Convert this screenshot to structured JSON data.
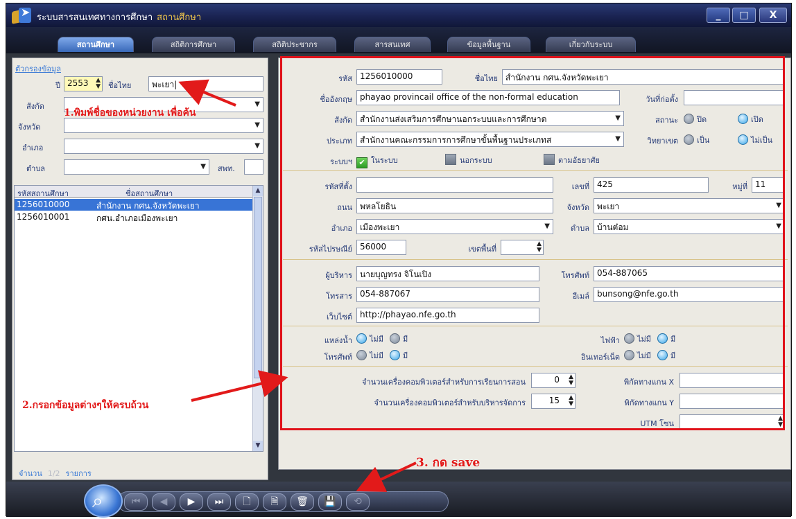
{
  "window": {
    "title": "ระบบสารสนเทศทางการศึกษา",
    "subtitle": "สถานศึกษา",
    "controls": [
      "_",
      "□",
      "X"
    ]
  },
  "tabs": [
    {
      "label": "สถานศึกษา",
      "active": true
    },
    {
      "label": "สถิติการศึกษา",
      "active": false
    },
    {
      "label": "สถิติประชากร",
      "active": false
    },
    {
      "label": "สารสนเทศ",
      "active": false
    },
    {
      "label": "ข้อมูลพื้นฐาน",
      "active": false
    },
    {
      "label": "เกี่ยวกับระบบ",
      "active": false
    }
  ],
  "filter": {
    "heading": "ตัวกรองข้อมูล",
    "year_label": "ปี",
    "year_value": "2553",
    "thai_name_label": "ชื่อไทย",
    "thai_name_value": "พะเยา|",
    "affiliation_label": "สังกัด",
    "province_label": "จังหวัด",
    "district_label": "อำเภอ",
    "subdistrict_label": "ตำบล",
    "office_label": "สพท."
  },
  "list": {
    "columns": [
      "รหัสสถานศึกษา",
      "ชื่อสถานศึกษา"
    ],
    "rows": [
      {
        "code": "1256010000",
        "name": "สำนักงาน กศน.จังหวัดพะเยา",
        "selected": true
      },
      {
        "code": "1256010001",
        "name": "กศน.อำเภอเมืองพะเยา",
        "selected": false
      }
    ],
    "count_label": "จำนวน",
    "count_value": "1/2",
    "count_unit": "รายการ"
  },
  "form": {
    "code_label": "รหัส",
    "code_value": "1256010000",
    "thai_name_label": "ชื่อไทย",
    "thai_name_value": "สำนักงาน กศน.จังหวัดพะเยา",
    "english_name_label": "ชื่ออังกฤษ",
    "english_name_value": "phayao provincail office of the non-formal education",
    "founded_label": "วันที่ก่อตั้ง",
    "founded_value": "",
    "affiliation_label": "สังกัด",
    "affiliation_value": "สำนักงานส่งเสริมการศึกษานอกระบบและการศึกษาต",
    "status_label": "สถานะ",
    "status_options": [
      "ปิด",
      "เปิด"
    ],
    "type_label": "ประเภท",
    "type_value": "สำนักงานคณะกรรมการการศึกษาขั้นพื้นฐานประเภทส",
    "college_label": "วิทยาเขต",
    "college_options": [
      "เป็น",
      "ไม่เป็น"
    ],
    "system_label": "ระบบฯ",
    "system_options": [
      {
        "label": "ในระบบ",
        "checked": true
      },
      {
        "label": "นอกระบบ",
        "checked": false
      },
      {
        "label": "ตามอัธยาศัย",
        "checked": false
      }
    ],
    "location_code_label": "รหัสที่ตั้ง",
    "location_code_value": "",
    "house_no_label": "เลขที่",
    "house_no_value": "425",
    "village_label": "หมู่ที่",
    "village_value": "11",
    "road_label": "ถนน",
    "road_value": "พหลโยธิน",
    "province_label": "จังหวัด",
    "province_value": "พะเยา",
    "district_label": "อำเภอ",
    "district_value": "เมืองพะเยา",
    "subdistrict_label": "ตำบล",
    "subdistrict_value": "บ้านต๋อม",
    "postal_label": "รหัสไปรษณีย์",
    "postal_value": "56000",
    "zone_label": "เขตพื้นที่",
    "zone_value": "",
    "director_label": "ผู้บริหาร",
    "director_value": "นายบุญทรง จิโนเปิง",
    "phone_label": "โทรศัพท์",
    "phone_value": "054-887065",
    "fax_label": "โทรสาร",
    "fax_value": "054-887067",
    "email_label": "อีเมล์",
    "email_value": "bunsong@nfe.go.th",
    "website_label": "เว็บไซต์",
    "website_value": "http://phayao.nfe.go.th",
    "water_label": "แหล่งน้ำ",
    "electricity_label": "ไฟฟ้า",
    "telephone_label": "โทรศัพท์",
    "internet_label": "อินเทอร์เน็ต",
    "no_label": "ไม่มี",
    "yes_label": "มี",
    "pc_teaching_label": "จำนวนเครื่องคอมพิวเตอร์สำหรับการเรียนการสอน",
    "pc_teaching_value": "0",
    "pc_admin_label": "จำนวนเครื่องคอมพิวเตอร์สำหรับบริหารจัดการ",
    "pc_admin_value": "15",
    "coord_x_label": "พิกัดทางแกน X",
    "coord_x_value": "",
    "coord_y_label": "พิกัดทางแกน Y",
    "coord_y_value": "",
    "utm_label": "UTM โซน",
    "utm_value": ""
  },
  "annotations": {
    "step1": "1.พิมพ์ชื่อของหน่วยงาน เพื่อค้น",
    "step2": "2.กรอกข้อมูลต่างๆให้ครบถ้วน",
    "step3": "3. กด save"
  },
  "toolbar": {
    "icons": [
      "search-icon",
      "first-record-icon",
      "previous-record-icon",
      "next-record-icon",
      "last-record-icon",
      "new-record-icon",
      "edit-record-icon",
      "delete-icon",
      "save-icon",
      "refresh-icon"
    ]
  },
  "colors": {
    "accent": "#3874d6",
    "annotation": "#e21a1a",
    "window_bg": "#31363e",
    "panel_bg": "#eceae3"
  }
}
